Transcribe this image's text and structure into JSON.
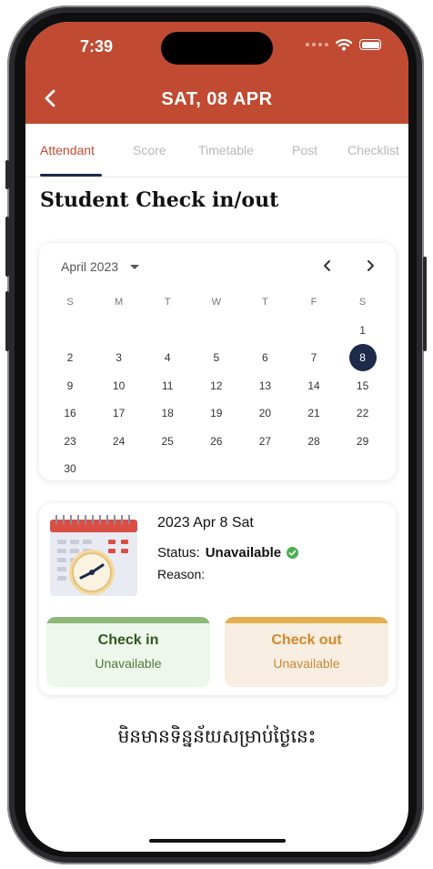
{
  "status_bar": {
    "time": "7:39"
  },
  "header": {
    "title": "SAT, 08 APR"
  },
  "tabs": [
    {
      "label": "Attendant",
      "active": true
    },
    {
      "label": "Score"
    },
    {
      "label": "Timetable"
    },
    {
      "label": "Post"
    },
    {
      "label": "Checklist"
    }
  ],
  "page_title": "Student Check in/out",
  "calendar": {
    "month_label": "April 2023",
    "weekdays": [
      "S",
      "M",
      "T",
      "W",
      "T",
      "F",
      "S"
    ],
    "days": [
      "1",
      "2",
      "3",
      "4",
      "5",
      "6",
      "7",
      "8",
      "9",
      "10",
      "11",
      "12",
      "13",
      "14",
      "15",
      "16",
      "17",
      "18",
      "19",
      "20",
      "21",
      "22",
      "23",
      "24",
      "25",
      "26",
      "27",
      "28",
      "29",
      "30"
    ],
    "selected_day": "8"
  },
  "status_card": {
    "date": "2023 Apr 8 Sat",
    "status_label": "Status:",
    "status_value": "Unavailable",
    "reason_label": "Reason:",
    "check_in": {
      "title": "Check in",
      "value": "Unavailable"
    },
    "check_out": {
      "title": "Check out",
      "value": "Unavailable"
    }
  },
  "no_data_text": "មិនមានទិន្នន័យសម្រាប់ថ្ងៃនេះ",
  "colors": {
    "brand": "#c04b32",
    "selected": "#1e2a4a",
    "success": "#4caf50"
  }
}
